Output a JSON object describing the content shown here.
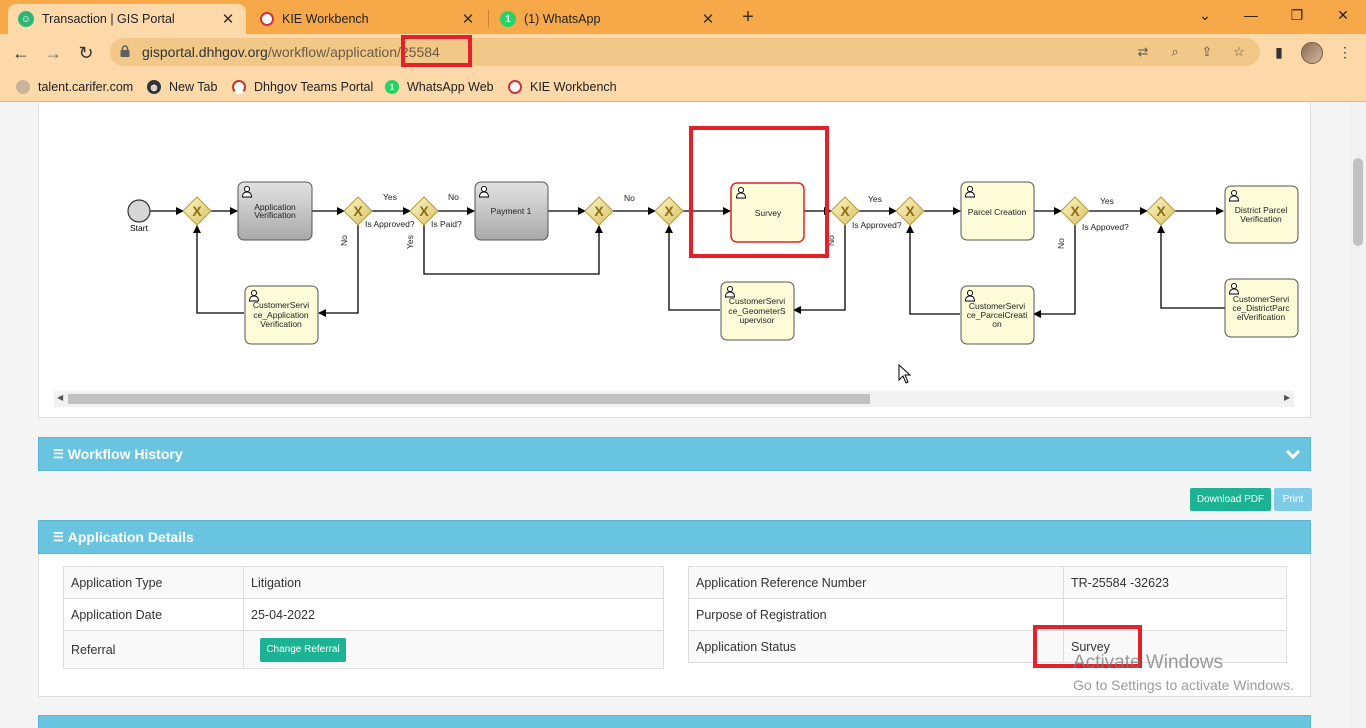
{
  "browser": {
    "tabs": [
      {
        "title": "Transaction | GIS Portal",
        "active": true
      },
      {
        "title": "KIE Workbench",
        "active": false
      },
      {
        "title": "(1) WhatsApp",
        "active": false
      }
    ],
    "address": {
      "host": "gisportal.dhhgov.org",
      "path": "/workflow/application",
      "id": "/25584"
    },
    "bookmarks": [
      "talent.carifer.com",
      "New Tab",
      "Dhhgov Teams Portal",
      "WhatsApp Web",
      "KIE Workbench"
    ]
  },
  "workflow": {
    "nodes": {
      "start": "Start",
      "app_verification": [
        "Application",
        "Verification"
      ],
      "cs_app_verification": [
        "CustomerServi",
        "ce_Application",
        "Verification"
      ],
      "payment": "Payment 1",
      "survey": "Survey",
      "cs_geometer": [
        "CustomerServi",
        "ce_GeometerS",
        "upervisor"
      ],
      "parcel_creation": "Parcel Creation",
      "cs_parcel": [
        "CustomerServi",
        "ce_ParcelCreati",
        "on"
      ],
      "district_parcel": [
        "District Parcel",
        "Verification"
      ],
      "cs_district": [
        "CustomerServi",
        "ce_DistrictParc",
        "elVerification"
      ]
    },
    "labels": {
      "yes": "Yes",
      "no": "No",
      "is_approved": "Is Approved?",
      "is_paid": "Is Paid?",
      "is_appoved": "Is Appoved?"
    }
  },
  "sections": {
    "history": "Workflow History",
    "details": "Application Details"
  },
  "buttons": {
    "download_pdf": "Download PDF",
    "print": "Print",
    "change_referral": "Change Referral"
  },
  "details": {
    "left": [
      {
        "label": "Application Type",
        "value": "Litigation"
      },
      {
        "label": "Application Date",
        "value": "25-04-2022"
      },
      {
        "label": "Referral",
        "value": ""
      }
    ],
    "right": [
      {
        "label": "Application Reference Number",
        "value": "TR-25584 -32623"
      },
      {
        "label": "Purpose of Registration",
        "value": ""
      },
      {
        "label": "Application Status",
        "value": "Survey"
      }
    ]
  },
  "watermark": {
    "title": "Activate Windows",
    "subtitle": "Go to Settings to activate Windows."
  },
  "colors": {
    "tabbar": "#f7a94a",
    "toolbar": "#fdd9a9",
    "section": "#69c4e0",
    "button_green": "#1bb394",
    "highlight": "#e3212b"
  }
}
